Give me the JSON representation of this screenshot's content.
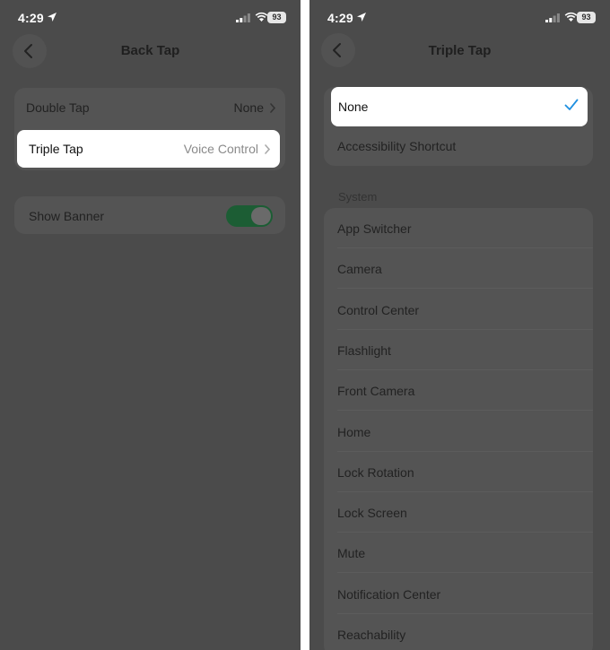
{
  "status_bar": {
    "time": "4:29",
    "battery": "93"
  },
  "left": {
    "title": "Back Tap",
    "rows": [
      {
        "label": "Double Tap",
        "value": "None"
      },
      {
        "label": "Triple Tap",
        "value": "Voice Control"
      }
    ],
    "show_banner": {
      "label": "Show Banner",
      "on": true
    }
  },
  "right": {
    "title": "Triple Tap",
    "selected": "None",
    "top_options": [
      "None",
      "Accessibility Shortcut"
    ],
    "section_header": "System",
    "system_options": [
      "App Switcher",
      "Camera",
      "Control Center",
      "Flashlight",
      "Front Camera",
      "Home",
      "Lock Rotation",
      "Lock Screen",
      "Mute",
      "Notification Center",
      "Reachability"
    ]
  },
  "colors": {
    "overlay": "#4b4b4b",
    "checkmark": "#1e8fe0",
    "toggle_on": "#1c5d34"
  },
  "icons": [
    "location-arrow-icon",
    "cellular-signal-icon",
    "wifi-icon",
    "battery-icon",
    "chevron-left-icon",
    "chevron-right-icon",
    "checkmark-icon"
  ]
}
